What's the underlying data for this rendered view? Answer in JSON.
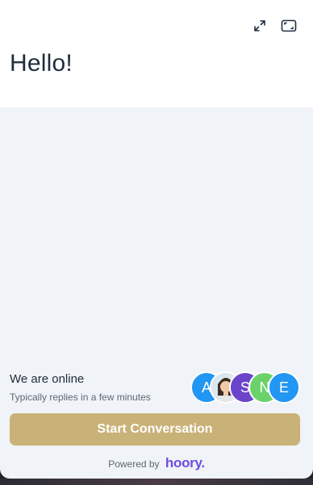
{
  "header": {
    "greeting": "Hello!",
    "expand_icon": "expand-arrows-icon",
    "fullscreen_icon": "fullscreen-frame-icon"
  },
  "status": {
    "title": "We are online",
    "subtitle": "Typically replies in a few minutes"
  },
  "agents": [
    {
      "initial": "A",
      "color": "#2196f3",
      "type": "initial"
    },
    {
      "initial": "",
      "color": "#e9c7a9",
      "type": "photo"
    },
    {
      "initial": "S",
      "color": "#6a45c9",
      "type": "initial"
    },
    {
      "initial": "N",
      "color": "#6bd26b",
      "type": "initial"
    },
    {
      "initial": "E",
      "color": "#2196f3",
      "type": "initial"
    }
  ],
  "cta": {
    "label": "Start Conversation",
    "color": "#c9b277"
  },
  "footer": {
    "powered_by": "Powered by",
    "brand": "hoory."
  }
}
